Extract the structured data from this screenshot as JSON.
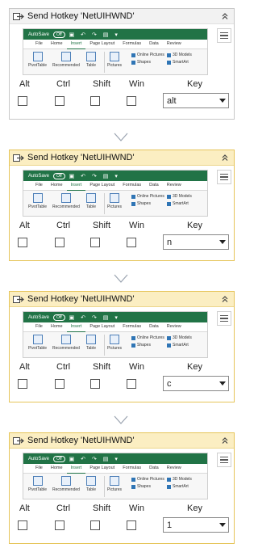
{
  "activities": [
    {
      "title": "Send Hotkey 'NetUIHWND'",
      "style": "plain",
      "modifiers": [
        "Alt",
        "Ctrl",
        "Shift",
        "Win"
      ],
      "key_label": "Key",
      "key_value": "alt"
    },
    {
      "title": "Send Hotkey 'NetUIHWND'",
      "style": "selected",
      "modifiers": [
        "Alt",
        "Ctrl",
        "Shift",
        "Win"
      ],
      "key_label": "Key",
      "key_value": "n"
    },
    {
      "title": "Send Hotkey 'NetUIHWND'",
      "style": "selected",
      "modifiers": [
        "Alt",
        "Ctrl",
        "Shift",
        "Win"
      ],
      "key_label": "Key",
      "key_value": "c"
    },
    {
      "title": "Send Hotkey 'NetUIHWND'",
      "style": "selected",
      "modifiers": [
        "Alt",
        "Ctrl",
        "Shift",
        "Win"
      ],
      "key_label": "Key",
      "key_value": "1"
    }
  ],
  "preview": {
    "autosave": "AutoSave",
    "toggle": "Off",
    "tabs": [
      "File",
      "Home",
      "Insert",
      "Page Layout",
      "Formulas",
      "Data",
      "Review"
    ],
    "active_tab": "Insert",
    "buttons": [
      "PivotTable",
      "Recommended",
      "Table",
      "Pictures"
    ],
    "small_items": [
      "Online Pictures",
      "Shapes",
      "3D Models",
      "SmartArt"
    ]
  },
  "colors": {
    "excel_green": "#217346",
    "selected_border": "#e6c55a",
    "selected_header": "#fbeec2",
    "plain_border": "#c8c8c8"
  },
  "icons": {
    "activity": "send-hotkey-icon",
    "collapse": "chevron-double-up-icon",
    "menu": "hamburger-menu-icon",
    "dropdown": "chevron-down-icon",
    "connector": "connector-arrow-icon"
  }
}
